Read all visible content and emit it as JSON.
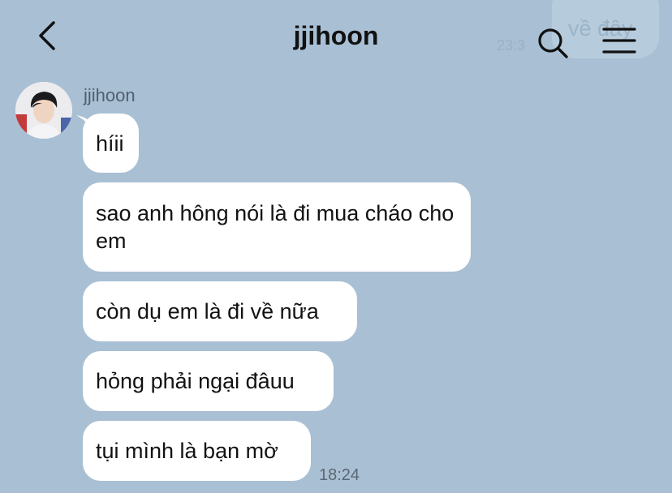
{
  "header": {
    "back_icon": "chevron-left-icon",
    "title": "jjihoon",
    "search_icon": "search-icon",
    "menu_icon": "hamburger-menu-icon"
  },
  "ghost_message": {
    "text": "về đây",
    "time": "23:3"
  },
  "conversation": {
    "sender_name": "jjihoon",
    "messages": [
      {
        "text": "híii"
      },
      {
        "text": "sao anh hông nói là đi mua cháo cho em"
      },
      {
        "text": "còn dụ em là đi về nữa"
      },
      {
        "text": "hỏng phải ngại đâuu"
      },
      {
        "text": "tụi mình là bạn mờ"
      }
    ],
    "last_time": "18:24"
  },
  "colors": {
    "background": "#a9bfd4",
    "bubble": "#ffffff",
    "text": "#121212"
  }
}
